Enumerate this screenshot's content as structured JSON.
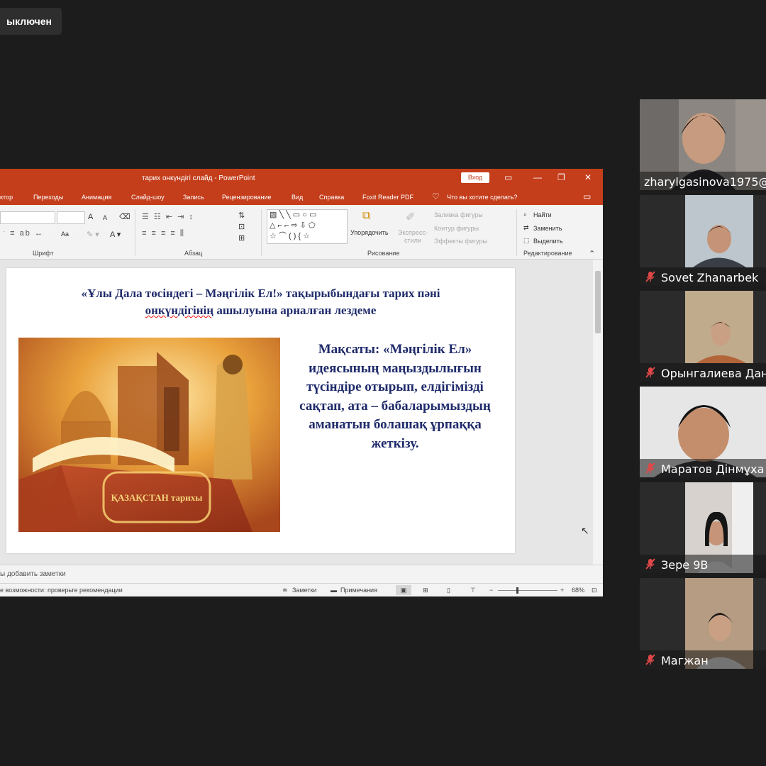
{
  "banner": {
    "mute_text": "ыключен"
  },
  "powerpoint": {
    "window_title": "тарих онкүндігі слайд  -  PowerPoint",
    "signin_label": "Вход",
    "tabs": [
      "ктор",
      "Переходы",
      "Анимация",
      "Слайд-шоу",
      "Запись",
      "Рецензирование",
      "Вид",
      "Справка",
      "Foxit Reader PDF",
      "Что вы хотите сделать?"
    ],
    "ribbon": {
      "font_group_label": "Шрифт",
      "paragraph_group_label": "Абзац",
      "drawing_group_label": "Рисование",
      "editing_group_label": "Редактирование",
      "arrange_label": "Упорядочить",
      "quick_styles_label": "Экспресс-стили",
      "shape_fill_label": "Заливка фигуры",
      "shape_outline_label": "Контур фигуры",
      "shape_effects_label": "Эффекты фигуры",
      "find_label": "Найти",
      "replace_label": "Заменить",
      "select_label": "Выделить",
      "font_size_big": "A",
      "font_size_small": "A",
      "change_case": "Aa"
    },
    "slide": {
      "title_part1": "«Ұлы Дала төсіндегі – Мәңгілік Ел!» тақырыбындағы тарих пәні",
      "title_word_underlined": "онкүндігінің",
      "title_part2": " ашылуына арналған лездеме",
      "body": "Мақсаты: «Мәңгілік Ел» идеясының маңыздылығын түсіндіре отырып, елдігімізді сақтап, ата – бабаларымыздың аманатын болашақ ұрпаққа жеткізу.",
      "book_text": "ҚАЗАҚСТАН тарихы"
    },
    "notes_placeholder": "ы добавить заметки",
    "status": {
      "accessibility": "е возможности: проверьте рекомендации",
      "notes_button": "Заметки",
      "comments_button": "Примечания",
      "zoom_minus": "−",
      "zoom_plus": "+",
      "zoom_value": "68%"
    }
  },
  "participants": [
    {
      "name": "zharylgasinova1975@",
      "muted": false
    },
    {
      "name": "Sovet Zhanarbek",
      "muted": true
    },
    {
      "name": "Орынгалиева Дан",
      "muted": true
    },
    {
      "name": "Маратов Дінмұха",
      "muted": true
    },
    {
      "name": "Зере 9В",
      "muted": true
    },
    {
      "name": "Магжан",
      "muted": true
    }
  ]
}
